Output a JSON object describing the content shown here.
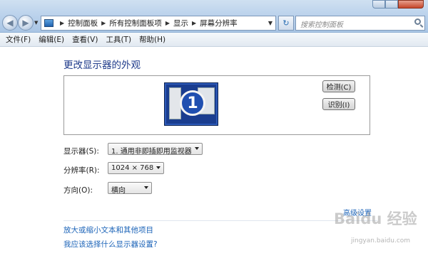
{
  "address_bar": {
    "breadcrumbs": [
      "控制面板",
      "所有控制面板项",
      "显示",
      "屏幕分辨率"
    ]
  },
  "search": {
    "placeholder": "搜索控制面板"
  },
  "menu": [
    "文件(F)",
    "编辑(E)",
    "查看(V)",
    "工具(T)",
    "帮助(H)"
  ],
  "main": {
    "heading": "更改显示器的外观",
    "monitor_number": "1",
    "detect_button": "检测(C)",
    "identify_button": "识别(I)",
    "display_label": "显示器(S):",
    "display_value": "1. 通用非即插即用监视器",
    "resolution_label": "分辨率(R):",
    "resolution_value": "1024 × 768",
    "orientation_label": "方向(O):",
    "orientation_value": "横向",
    "advanced_link": "高级设置",
    "link_text_size": "放大或缩小文本和其他项目",
    "link_help": "我应该选择什么显示器设置?"
  },
  "watermark": {
    "brand": "Baidu 经验",
    "url": "jingyan.baidu.com"
  },
  "colors": {
    "link": "#1b63b8",
    "heading": "#1e3a8a",
    "monitor": "#1a3d8f"
  }
}
